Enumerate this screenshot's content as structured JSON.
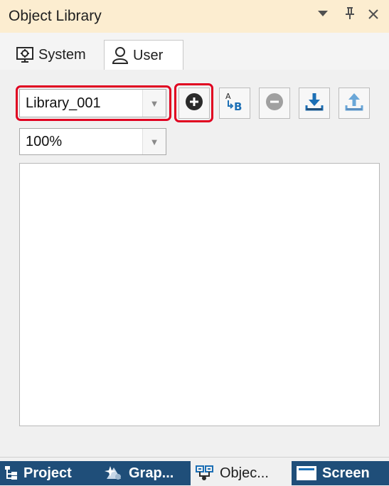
{
  "window": {
    "title": "Object Library",
    "controls": [
      "dropdown-icon",
      "pin-icon",
      "close-icon"
    ]
  },
  "tabs": [
    {
      "label": "System",
      "icon": "system-icon",
      "active": false
    },
    {
      "label": "User",
      "icon": "user-icon",
      "active": true
    }
  ],
  "toolbar": {
    "library_value": "Library_001",
    "zoom_value": "100%",
    "buttons": [
      "add-library-icon",
      "rename-icon",
      "remove-library-icon",
      "import-icon",
      "export-icon"
    ]
  },
  "bottom_tabs": [
    {
      "label": "Project",
      "icon": "project-icon",
      "active": false
    },
    {
      "label": "Grap...",
      "icon": "graphics-icon",
      "active": false
    },
    {
      "label": "Objec...",
      "icon": "object-icon",
      "active": true
    },
    {
      "label": "Screen",
      "icon": "screen-icon",
      "active": false
    }
  ],
  "colors": {
    "titlebar": "#fcedd0",
    "highlight": "#e00020",
    "accent_blue": "#1c6fb5",
    "bottom_bar": "#1f4e79"
  }
}
